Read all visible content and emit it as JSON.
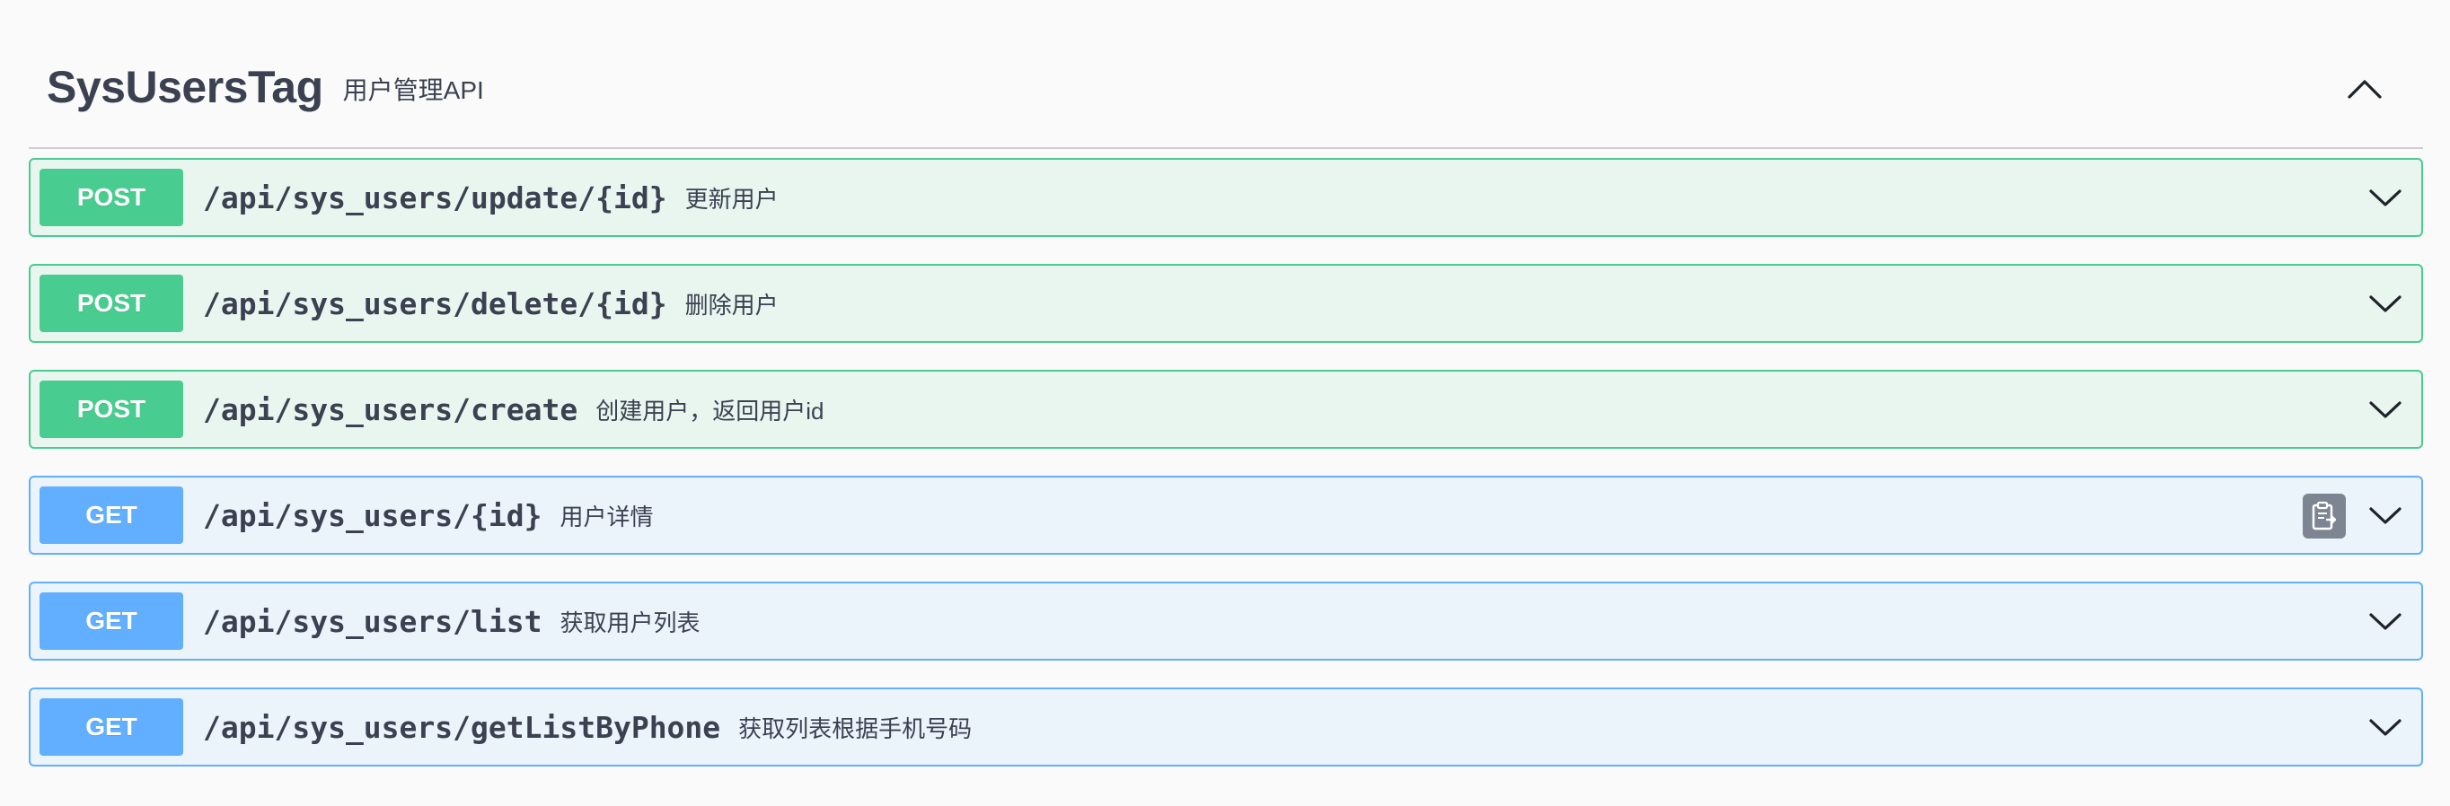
{
  "tag": {
    "name": "SysUsersTag",
    "description": "用户管理API"
  },
  "operations": [
    {
      "method": "POST",
      "path": "/api/sys_users/update/{id}",
      "summary": "更新用户"
    },
    {
      "method": "POST",
      "path": "/api/sys_users/delete/{id}",
      "summary": "删除用户"
    },
    {
      "method": "POST",
      "path": "/api/sys_users/create",
      "summary": "创建用户，返回用户id"
    },
    {
      "method": "GET",
      "path": "/api/sys_users/{id}",
      "summary": "用户详情"
    },
    {
      "method": "GET",
      "path": "/api/sys_users/list",
      "summary": "获取用户列表"
    },
    {
      "method": "GET",
      "path": "/api/sys_users/getListByPhone",
      "summary": "获取列表根据手机号码"
    }
  ],
  "colors": {
    "post": "#49cc90",
    "get": "#61affe",
    "copy_button": "#7d8492"
  },
  "icons": {
    "collapse": "chevron-up-icon",
    "expand": "chevron-down-icon",
    "copy": "clipboard-copy-icon"
  }
}
